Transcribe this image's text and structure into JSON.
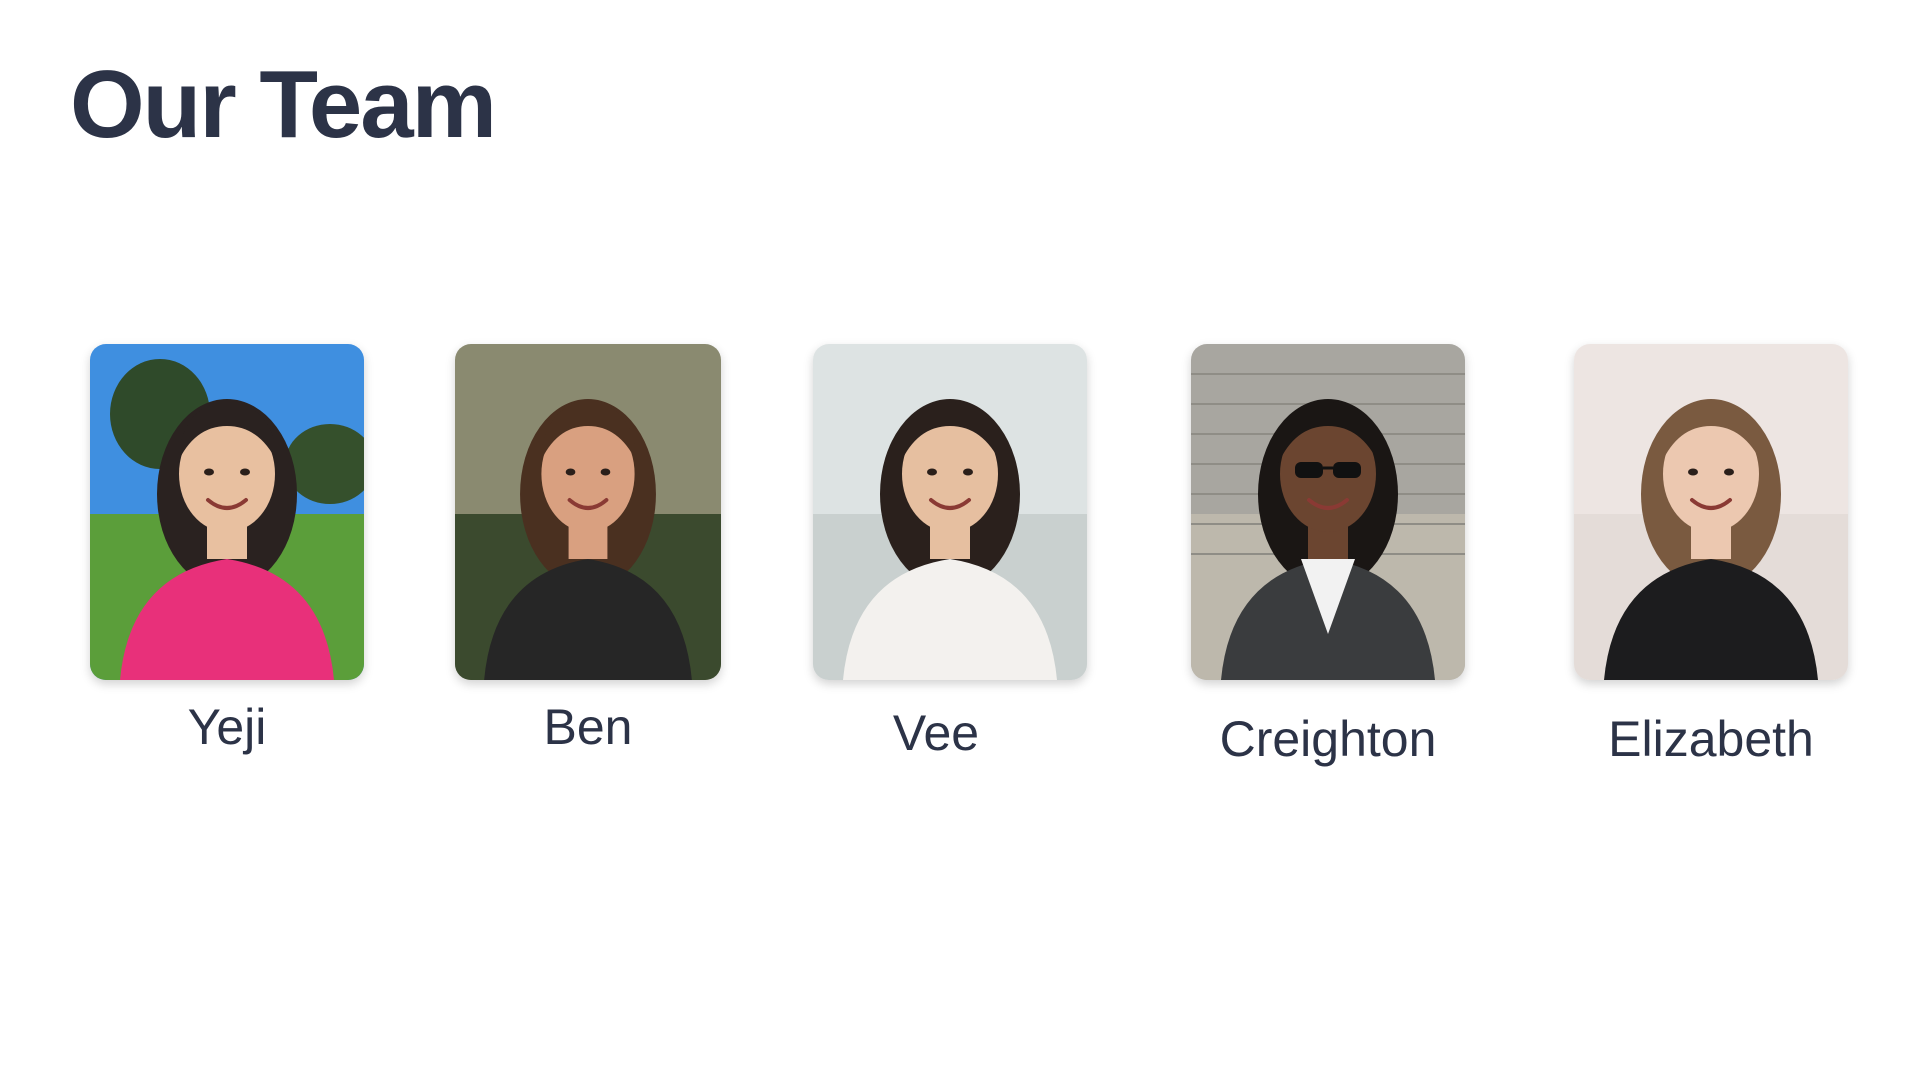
{
  "page": {
    "title": "Our Team"
  },
  "team": [
    {
      "name": "Yeji",
      "photo_icon": "portrait-photo",
      "colors": {
        "background": "#3f8fe0",
        "ground": "#5b9e3a",
        "clothing": "#e8307a",
        "hair": "#2a2220",
        "skin": "#e8c0a0"
      }
    },
    {
      "name": "Ben",
      "photo_icon": "portrait-photo",
      "colors": {
        "background": "#8a8a70",
        "ground": "#3b4a2e",
        "clothing": "#262626",
        "hair": "#4a3020",
        "skin": "#d9a080"
      }
    },
    {
      "name": "Vee",
      "photo_icon": "portrait-photo",
      "colors": {
        "background": "#dde3e3",
        "ground": "#c9d0cf",
        "clothing": "#f3f1ee",
        "hair": "#2a201c",
        "skin": "#e6bfa0"
      }
    },
    {
      "name": "Creighton",
      "photo_icon": "portrait-photo",
      "colors": {
        "background": "#a8a6a0",
        "ground": "#bdb8ac",
        "clothing": "#3a3c3e",
        "hair": "#1a1614",
        "skin": "#6b4530"
      }
    },
    {
      "name": "Elizabeth",
      "photo_icon": "portrait-photo",
      "colors": {
        "background": "#ede5e2",
        "ground": "#e4dcd8",
        "clothing": "#1c1c1e",
        "hair": "#7a5a40",
        "skin": "#ecc8b0"
      }
    }
  ]
}
